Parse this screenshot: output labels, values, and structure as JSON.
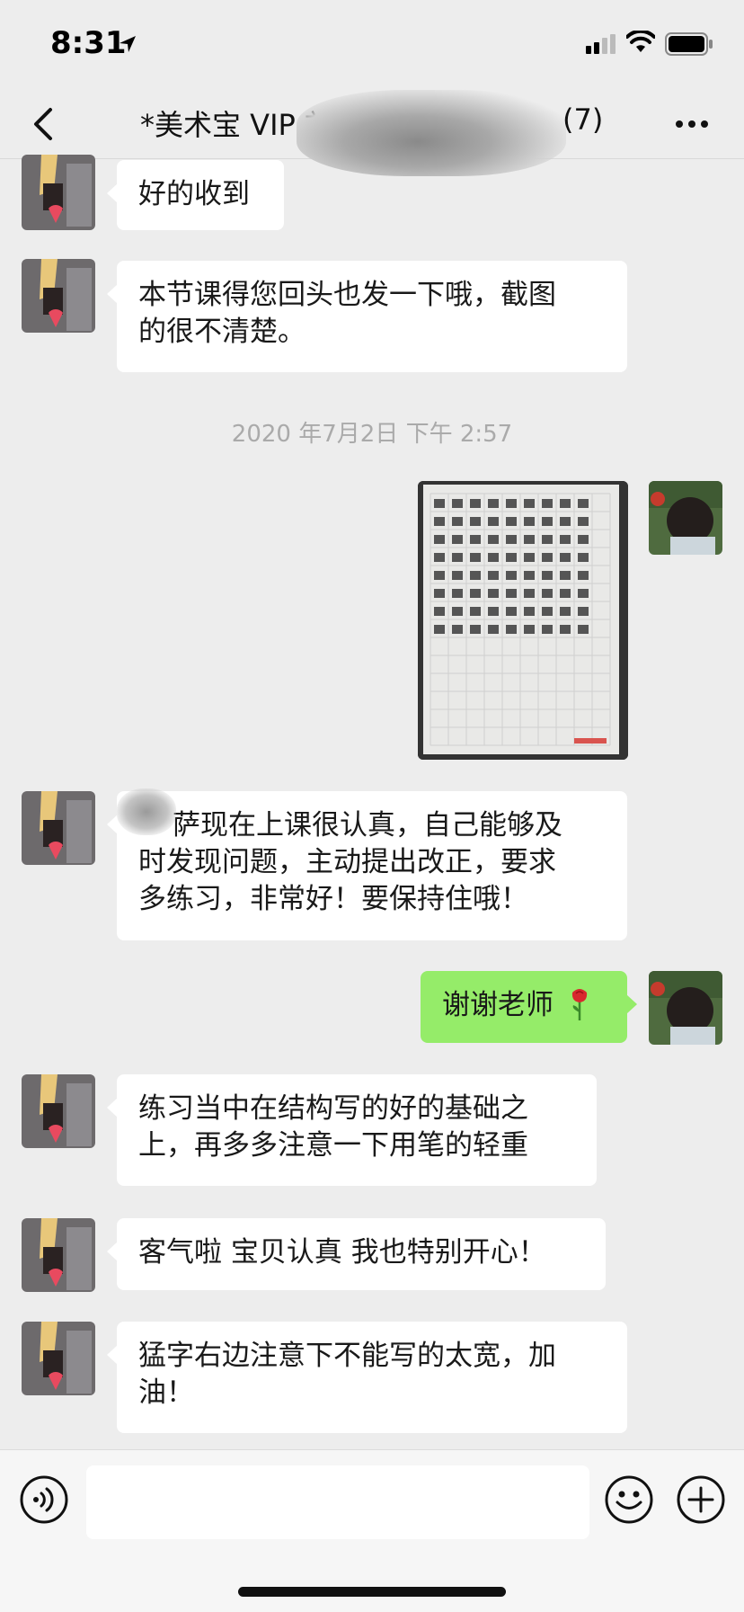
{
  "status_bar": {
    "time": "8:31"
  },
  "header": {
    "title": "*美术宝 VIP 刘",
    "member_count": "(7)"
  },
  "messages": [
    {
      "side": "left",
      "type": "text",
      "lines": [
        "好的收到"
      ]
    },
    {
      "side": "left",
      "type": "text",
      "lines": [
        "本节课得您回头也发一下哦，截图",
        "的很不清楚。"
      ]
    },
    {
      "type": "timestamp",
      "text": "2020 年7月2日 下午 2:57"
    },
    {
      "side": "right",
      "type": "image",
      "description": "homework-practice-sheet"
    },
    {
      "side": "left",
      "type": "text",
      "lines": [
        "萨现在上课很认真，自己能够及",
        "时发现问题，主动提出改正，要求",
        "多练习，非常好！要保持住哦！"
      ]
    },
    {
      "side": "right",
      "type": "text",
      "lines": [
        "谢谢老师"
      ],
      "emoji": "rose"
    },
    {
      "side": "left",
      "type": "text",
      "lines": [
        "练习当中在结构写的好的基础之",
        "上，再多多注意一下用笔的轻重"
      ]
    },
    {
      "side": "left",
      "type": "text",
      "lines": [
        "客气啦 宝贝认真 我也特别开心！"
      ]
    },
    {
      "side": "left",
      "type": "text",
      "lines": [
        "猛字右边注意下不能写的太宽，加",
        "油！"
      ]
    }
  ],
  "input_bar": {
    "placeholder": ""
  },
  "colors": {
    "background": "#ededed",
    "bubble_left": "#ffffff",
    "bubble_right": "#95ec69",
    "timestamp": "#aaaaaa"
  },
  "icons": [
    "location-arrow-icon",
    "signal-icon",
    "wifi-icon",
    "battery-icon",
    "back-icon",
    "more-icon",
    "voice-icon",
    "emoji-icon",
    "plus-icon",
    "rose-emoji-icon"
  ]
}
